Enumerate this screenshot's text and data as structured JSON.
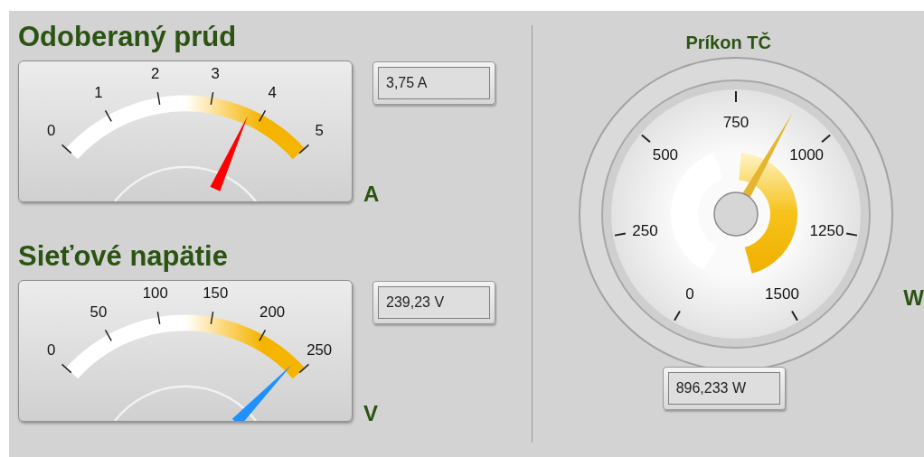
{
  "meters": [
    {
      "title": "Odoberaný prúd",
      "ticks": [
        "0",
        "1",
        "2",
        "3",
        "4",
        "5"
      ],
      "level": 0.75,
      "color": "#ff0000",
      "unit": "A",
      "reading": "3,75 A"
    },
    {
      "title": "Sieťové napätie",
      "ticks": [
        "0",
        "50",
        "100",
        "150",
        "200",
        "250"
      ],
      "level": 0.957,
      "color": "#1e90ff",
      "unit": "V",
      "reading": "239,23 V"
    }
  ],
  "dial": {
    "title": "Príkon TČ",
    "ticks": [
      "0",
      "250",
      "500",
      "750",
      "1000",
      "1250",
      "1500"
    ],
    "level": 0.5975,
    "unit": "W",
    "reading": "896,233 W"
  }
}
